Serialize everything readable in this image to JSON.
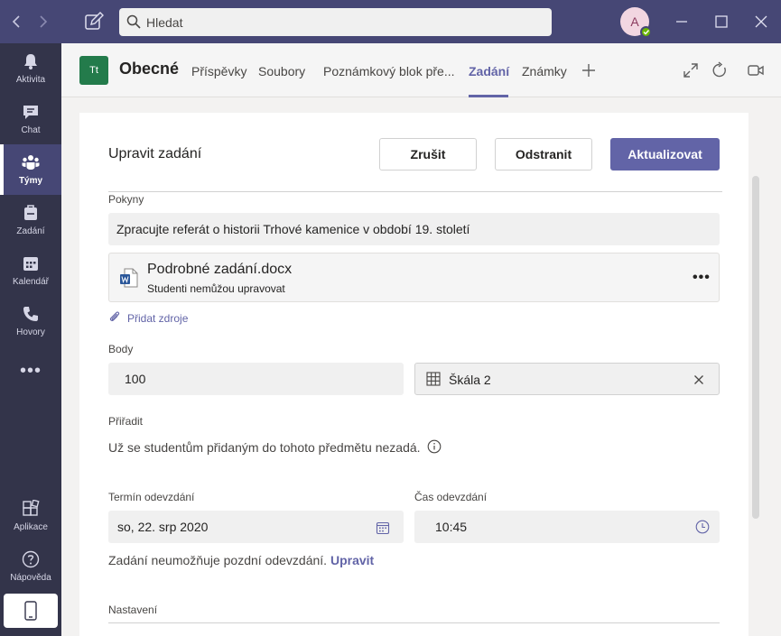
{
  "search": {
    "placeholder": "Hledat"
  },
  "user": {
    "initials": "A"
  },
  "rail": {
    "items": [
      {
        "label": "Aktivita",
        "icon": "bell-icon"
      },
      {
        "label": "Chat",
        "icon": "chat-icon"
      },
      {
        "label": "Týmy",
        "icon": "teams-icon",
        "active": true
      },
      {
        "label": "Zadání",
        "icon": "assignments-icon"
      },
      {
        "label": "Kalendář",
        "icon": "calendar-icon"
      },
      {
        "label": "Hovory",
        "icon": "phone-icon"
      }
    ],
    "more": "•••",
    "apps": "Aplikace",
    "help": "Nápověda"
  },
  "channel": {
    "team_initials": "Tt",
    "name": "Obecné",
    "tabs": [
      "Příspěvky",
      "Soubory",
      "Poznámkový blok pře...",
      "Zadání",
      "Známky"
    ],
    "active_tab": "Zadání"
  },
  "form": {
    "title": "Upravit zadání",
    "buttons": {
      "cancel": "Zrušit",
      "delete": "Odstranit",
      "update": "Aktualizovat"
    },
    "instructions_label": "Pokyny",
    "instructions_value": "Zpracujte referát o historii Trhové kamenice v období 19. století",
    "attachment": {
      "name": "Podrobné zadání.docx",
      "permission": "Studenti nemůžou upravovat",
      "more": "•••"
    },
    "add_resources": "Přidat zdroje",
    "points_label": "Body",
    "points_value": "100",
    "rubric": "Škála 2",
    "assign_label": "Přiřadit",
    "assign_text": "Už se studentům přidaným do tohoto předmětu nezadá.",
    "due_date_label": "Termín odevzdání",
    "due_date_value": "so, 22. srp 2020",
    "due_time_label": "Čas odevzdání",
    "due_time_value": "10:45",
    "late_text": "Zadání neumožňuje pozdní odevzdání.",
    "late_link": "Upravit",
    "settings_label": "Nastavení"
  },
  "colors": {
    "brand": "#6264a7",
    "titlebar": "#464775",
    "rail": "#33344a"
  }
}
